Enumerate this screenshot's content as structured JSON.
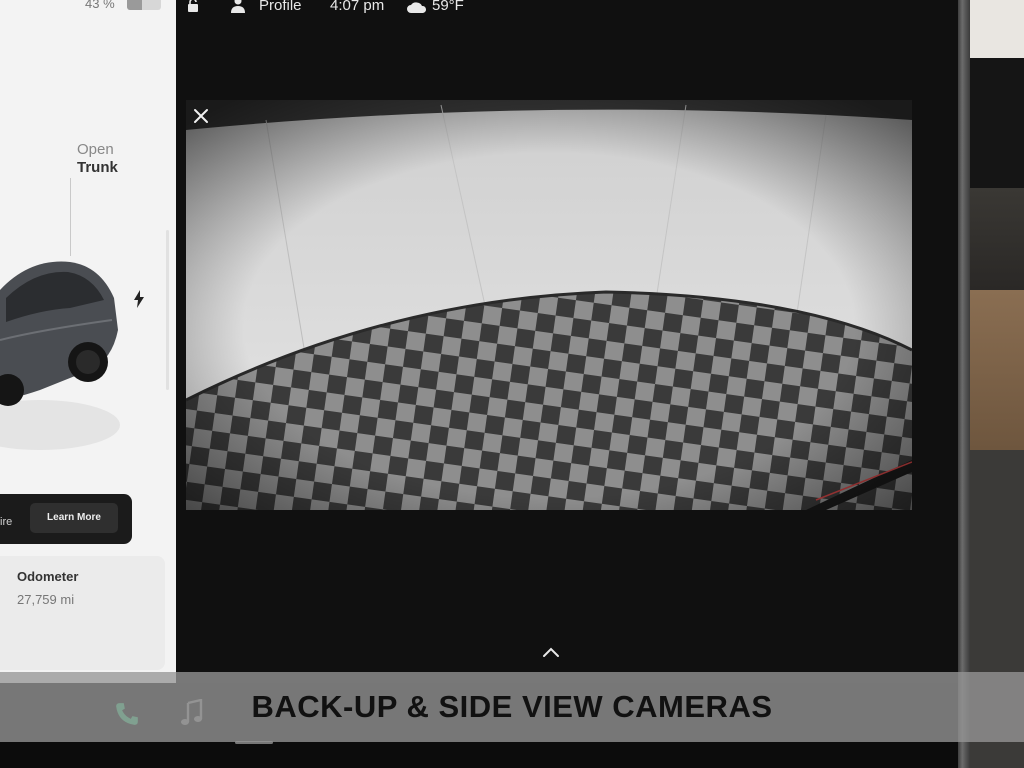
{
  "status_bar": {
    "battery_percent": "43 %",
    "battery_level": 0.43,
    "profile_label": "Profile",
    "time": "4:07 pm",
    "temperature": "59°F",
    "icons": [
      "lock-icon",
      "person-icon",
      "cloud-icon"
    ]
  },
  "left_panel": {
    "trunk_open_label": "Open",
    "trunk_label": "Trunk",
    "promo_text": "ire",
    "promo_button": "Learn More",
    "odometer_title": "Odometer",
    "odometer_value": "27,759 mi"
  },
  "camera": {
    "view": "back-up camera",
    "close_icon": "close-icon",
    "expand_icon": "chevron-up-icon"
  },
  "dock": {
    "icons": [
      "phone-icon",
      "music-icon"
    ]
  },
  "banner": {
    "text": "BACK-UP & SIDE VIEW CAMERAS"
  },
  "colors": {
    "phone_green": "#35c27a",
    "screen_dark": "#101010",
    "panel_light": "#f3f3f3"
  }
}
